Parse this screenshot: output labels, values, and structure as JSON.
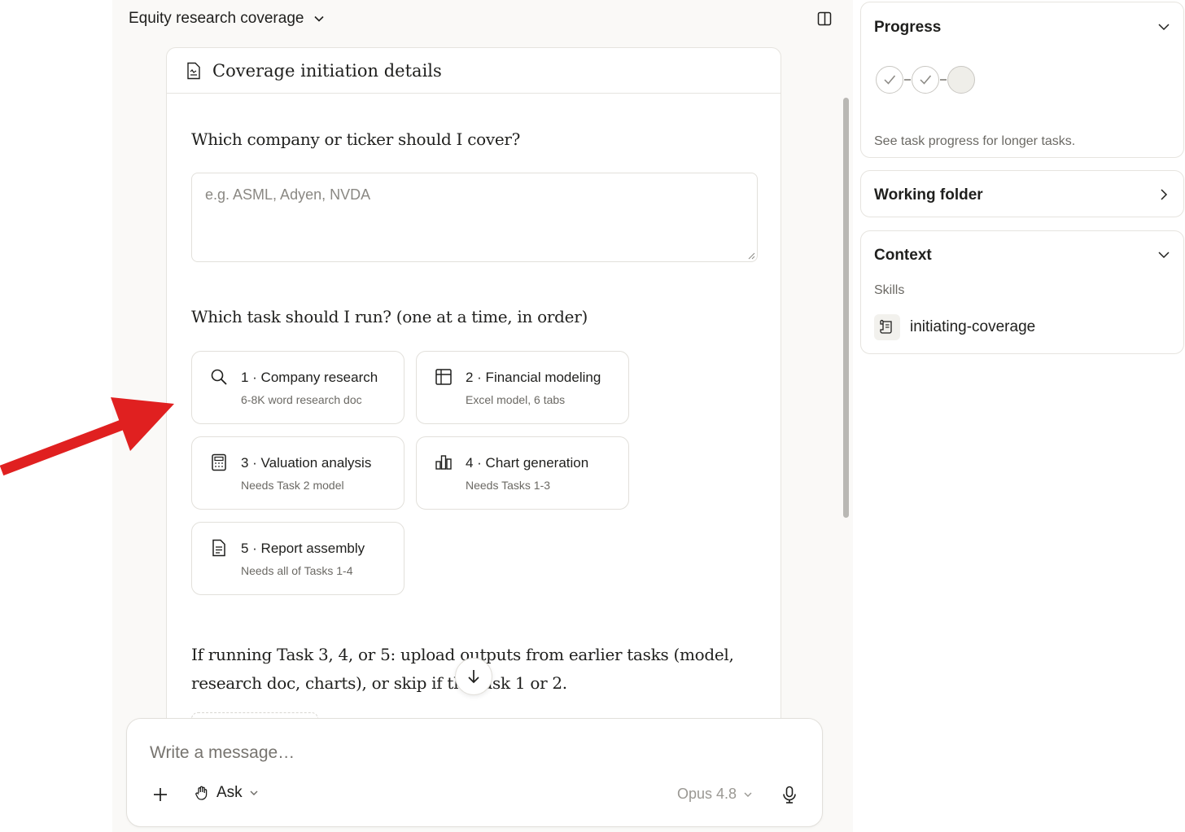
{
  "topbar": {
    "title": "Equity research coverage"
  },
  "card": {
    "title": "Coverage initiation details",
    "question_ticker": "Which company or ticker should I cover?",
    "ticker_placeholder": "e.g. ASML, Adyen, NVDA",
    "ticker_value": "",
    "question_task": "Which task should I run? (one at a time, in order)",
    "tasks": [
      {
        "icon": "search-icon",
        "label": "1 · Company research",
        "sub": "6-8K word research doc"
      },
      {
        "icon": "table-icon",
        "label": "2 · Financial modeling",
        "sub": "Excel model, 6 tabs"
      },
      {
        "icon": "calculator-icon",
        "label": "3 · Valuation analysis",
        "sub": "Needs Task 2 model"
      },
      {
        "icon": "bar-chart-icon",
        "label": "4 · Chart generation",
        "sub": "Needs Tasks 1-3"
      },
      {
        "icon": "document-icon",
        "label": "5 · Report assembly",
        "sub": "Needs all of Tasks 1-4"
      }
    ],
    "question_upload": "If running Task 3, 4, or 5: upload outputs from earlier tasks (model, research doc, charts), or skip if thi   Task 1 or 2."
  },
  "composer": {
    "placeholder": "Write a message…",
    "value": "",
    "mode_label": "Ask",
    "model_label": "Opus 4.8"
  },
  "sidebar": {
    "progress": {
      "title": "Progress",
      "steps": [
        "done",
        "done",
        "pending"
      ],
      "note": "See task progress for longer tasks."
    },
    "working_folder": {
      "title": "Working folder"
    },
    "context": {
      "title": "Context",
      "skills_label": "Skills",
      "skills": [
        "initiating-coverage"
      ]
    }
  },
  "annotation": {
    "arrow_color": "#e02020"
  },
  "colors": {
    "background": "#faf9f7",
    "card_border": "#e6e4df",
    "text": "#1f1f1d",
    "muted": "#6b6964"
  }
}
